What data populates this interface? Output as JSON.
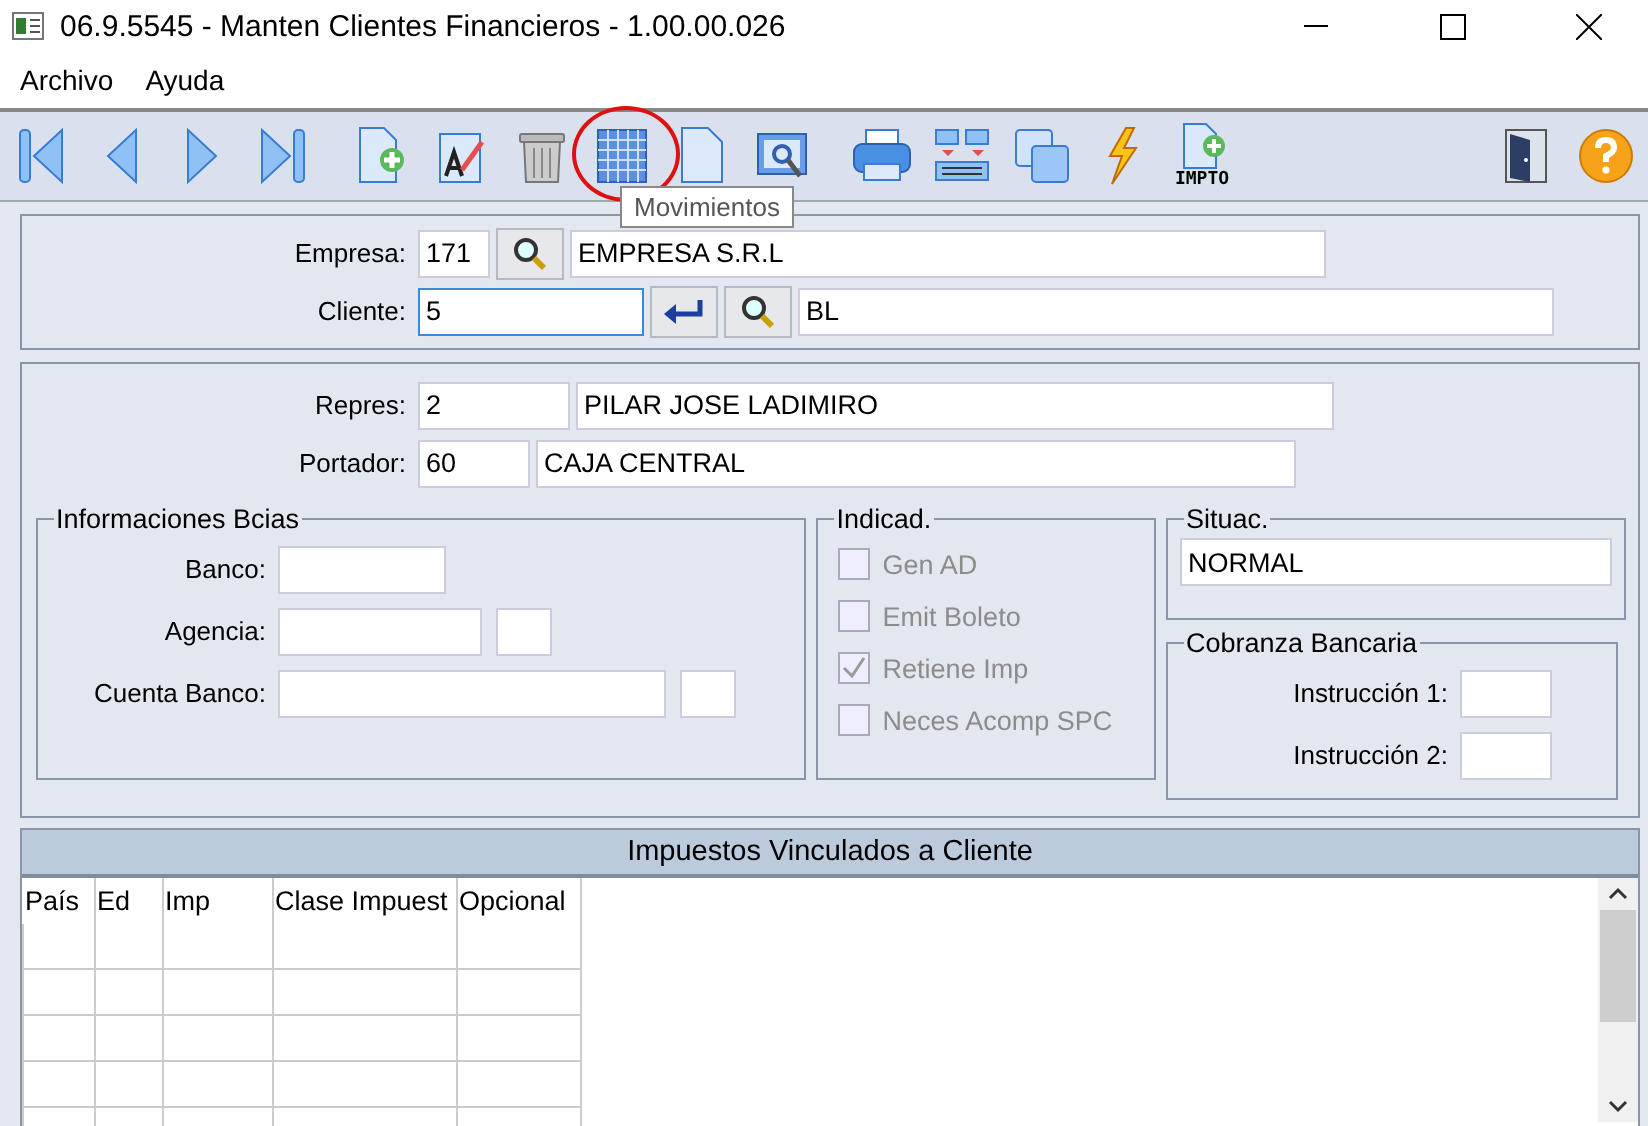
{
  "window": {
    "title": "06.9.5545 - Manten Clientes Financieros - 1.00.00.026"
  },
  "menu": [
    "Archivo",
    "Ayuda"
  ],
  "toolbar": [
    {
      "kind": "first",
      "circled": false
    },
    {
      "kind": "prev",
      "circled": false
    },
    {
      "kind": "next",
      "circled": false
    },
    {
      "kind": "last",
      "circled": false
    },
    {
      "kind": "new",
      "circled": false
    },
    {
      "kind": "edit",
      "circled": false
    },
    {
      "kind": "delete",
      "circled": false
    },
    {
      "kind": "grid",
      "circled": true,
      "tooltip": "Movimientos"
    },
    {
      "kind": "document",
      "circled": false
    },
    {
      "kind": "preview",
      "circled": false
    },
    {
      "kind": "print",
      "circled": false
    },
    {
      "kind": "list",
      "circled": false
    },
    {
      "kind": "copy",
      "circled": false
    },
    {
      "kind": "lightning",
      "circled": false
    },
    {
      "kind": "impto",
      "circled": false,
      "label": "IMPTO"
    },
    {
      "kind": "exit",
      "circled": false
    },
    {
      "kind": "help",
      "circled": false
    }
  ],
  "empresa": {
    "label": "Empresa:",
    "code": "171",
    "name": "EMPRESA  S.R.L"
  },
  "cliente": {
    "label": "Cliente:",
    "code": "5",
    "name": "BL",
    "focused": true
  },
  "repres": {
    "label": "Repres:",
    "code": "2",
    "name": "PILAR JOSE LADIMIRO"
  },
  "portador": {
    "label": "Portador:",
    "code": "60",
    "name": "CAJA CENTRAL"
  },
  "bank_info": {
    "title": "Informaciones Bcias",
    "fields": [
      {
        "label": "Banco:"
      },
      {
        "label": "Agencia:"
      },
      {
        "label": "Cuenta Banco:"
      }
    ]
  },
  "indicators": {
    "title": "Indicad.",
    "items": [
      {
        "label": "Gen AD",
        "checked": false,
        "disabled": true
      },
      {
        "label": "Emit Boleto",
        "checked": false,
        "disabled": true
      },
      {
        "label": "Retiene Imp",
        "checked": true,
        "disabled": true
      },
      {
        "label": "Neces Acomp SPC",
        "checked": false,
        "disabled": true
      }
    ]
  },
  "situation": {
    "title": "Situac.",
    "value": "NORMAL"
  },
  "cobranza": {
    "title": "Cobranza Bancaria",
    "fields": [
      {
        "label": "Instrucción 1:"
      },
      {
        "label": "Instrucción 2:"
      }
    ]
  },
  "taxes": {
    "title": "Impuestos Vinculados a Cliente",
    "columns": [
      "País",
      "Ed",
      "Imp",
      "Clase Impuest",
      "Opcional"
    ]
  }
}
